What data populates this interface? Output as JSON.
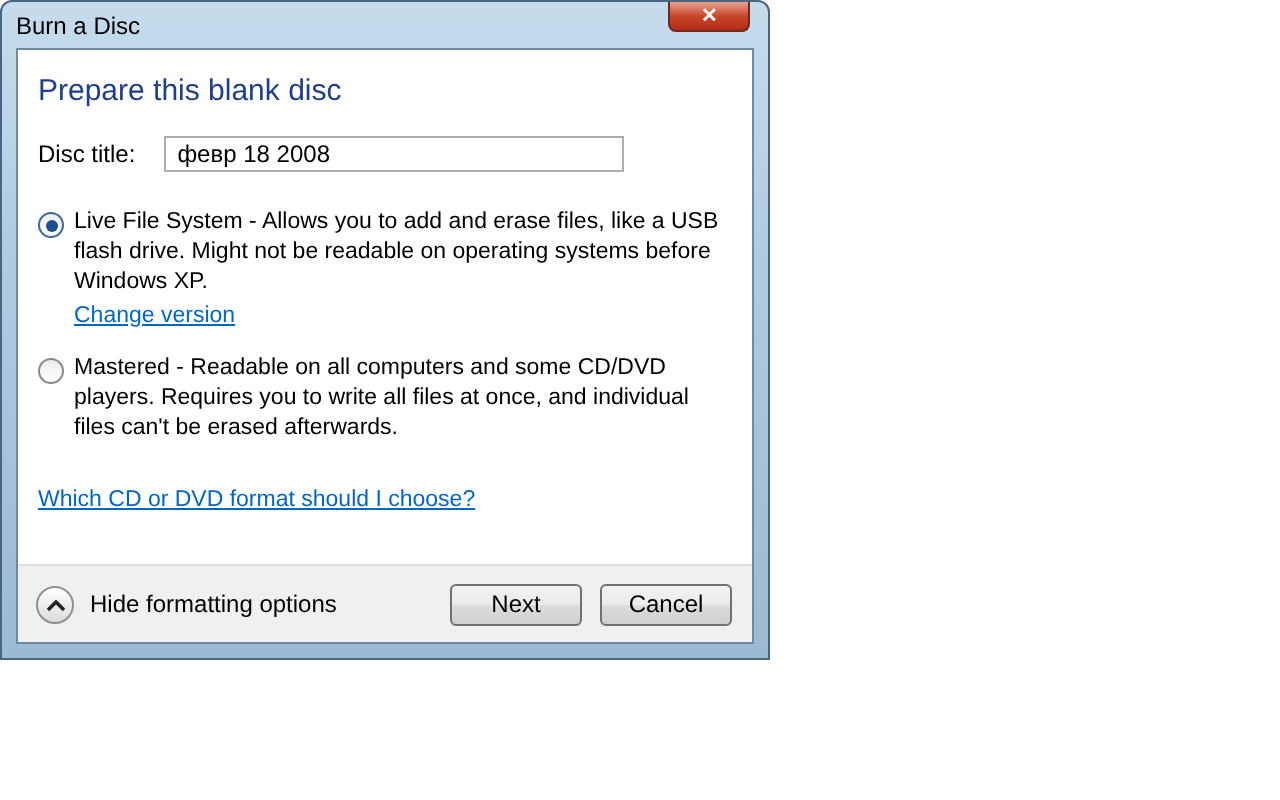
{
  "window": {
    "title": "Burn a Disc",
    "close": "✕"
  },
  "heading": "Prepare this blank disc",
  "disc_title": {
    "label": "Disc title:",
    "value": "февр 18 2008"
  },
  "options": [
    {
      "text": "Live File System - Allows you to add and erase files, like a USB flash drive. Might not be readable on operating systems before Windows XP.",
      "selected": true,
      "link": "Change version"
    },
    {
      "text": "Mastered - Readable on all computers and some CD/DVD players. Requires you to write all files at once, and individual files can't be erased afterwards.",
      "selected": false
    }
  ],
  "help_link": "Which CD or DVD format should I choose?",
  "footer": {
    "toggle_label": "Hide formatting options",
    "expanded": true,
    "buttons": [
      "Next",
      "Cancel"
    ]
  }
}
